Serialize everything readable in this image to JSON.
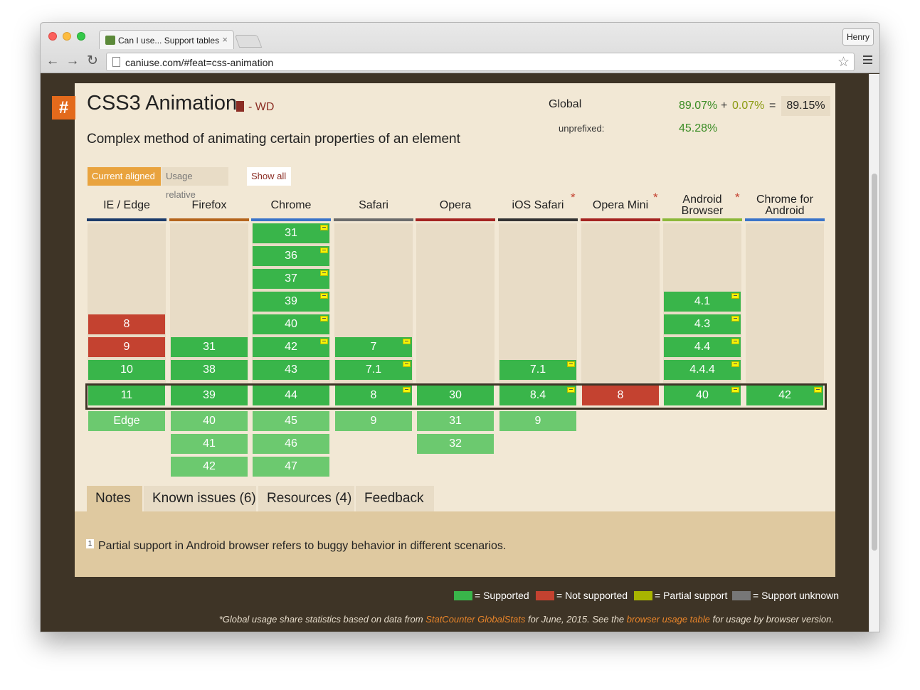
{
  "window": {
    "tab_title": "Can I use... Support tables",
    "tab_close": "×",
    "profile_name": "Henry",
    "url": "caniuse.com/#feat=css-animation"
  },
  "feature": {
    "hash": "#",
    "title": "CSS3 Animation",
    "status": "- WD",
    "description": "Complex method of animating certain properties of an element"
  },
  "usage": {
    "global_label": "Global",
    "unprefixed_label": "unprefixed:",
    "supported_pct": "89.07%",
    "plus": "+",
    "partial_pct": "0.07%",
    "equals": "=",
    "total_pct": "89.15%",
    "unprefixed_pct": "45.28%"
  },
  "view_buttons": {
    "current_aligned": "Current aligned",
    "usage_relative": "Usage relative",
    "show_all": "Show all"
  },
  "browsers": [
    {
      "name_line1": "IE / Edge",
      "name_line2": "",
      "color": "#1c3b6a",
      "asterisk": false
    },
    {
      "name_line1": "Firefox",
      "name_line2": "",
      "color": "#b5651d",
      "asterisk": false
    },
    {
      "name_line1": "Chrome",
      "name_line2": "",
      "color": "#3a74c9",
      "asterisk": false
    },
    {
      "name_line1": "Safari",
      "name_line2": "",
      "color": "#6b6b6b",
      "asterisk": false
    },
    {
      "name_line1": "Opera",
      "name_line2": "",
      "color": "#a52421",
      "asterisk": false
    },
    {
      "name_line1": "iOS Safari",
      "name_line2": "",
      "color": "#333333",
      "asterisk": true
    },
    {
      "name_line1": "Opera Mini",
      "name_line2": "",
      "color": "#a52421",
      "asterisk": true
    },
    {
      "name_line1": "Android",
      "name_line2": "Browser",
      "color": "#8cb83a",
      "asterisk": true
    },
    {
      "name_line1": "Chrome for",
      "name_line2": "Android",
      "color": "#3a74c9",
      "asterisk": false
    }
  ],
  "asterisk_symbol": "*",
  "versions": {
    "ie": {
      "v8": "8",
      "v9": "9",
      "v10": "10",
      "current": "11",
      "future1": "Edge"
    },
    "firefox": {
      "v31": "31",
      "v38": "38",
      "current": "39",
      "future1": "40",
      "future2": "41",
      "future3": "42"
    },
    "chrome": {
      "v31": "31",
      "v36": "36",
      "v37": "37",
      "v39": "39",
      "v40": "40",
      "v42": "42",
      "v43": "43",
      "current": "44",
      "future1": "45",
      "future2": "46",
      "future3": "47"
    },
    "safari": {
      "v7": "7",
      "v71": "7.1",
      "current": "8",
      "future1": "9"
    },
    "opera": {
      "current": "30",
      "future1": "31",
      "future2": "32"
    },
    "ios": {
      "v71": "7.1",
      "current": "8.4",
      "future1": "9"
    },
    "opera_mini": {
      "current": "8"
    },
    "android": {
      "v41": "4.1",
      "v43": "4.3",
      "v44": "4.4",
      "v444": "4.4.4",
      "current": "40"
    },
    "chrome_android": {
      "current": "42"
    }
  },
  "tabs": {
    "notes": "Notes",
    "known_issues": "Known issues (6)",
    "resources": "Resources (4)",
    "feedback": "Feedback"
  },
  "notes": {
    "footnote_num": "1",
    "text": "Partial support in Android browser refers to buggy behavior in different scenarios."
  },
  "legend": {
    "supported": "= Supported",
    "not_supported": "= Not supported",
    "partial": "= Partial support",
    "unknown": "= Support unknown",
    "colors": {
      "supported": "#39b54a",
      "not_supported": "#c44230",
      "partial": "#a8b400",
      "unknown": "#777777"
    }
  },
  "stat_note": {
    "part1": "*Global usage share statistics based on data from ",
    "link1": "StatCounter GlobalStats",
    "part2": " for June, 2015. See the ",
    "link2": "browser usage table",
    "part3": " for usage by browser version."
  }
}
